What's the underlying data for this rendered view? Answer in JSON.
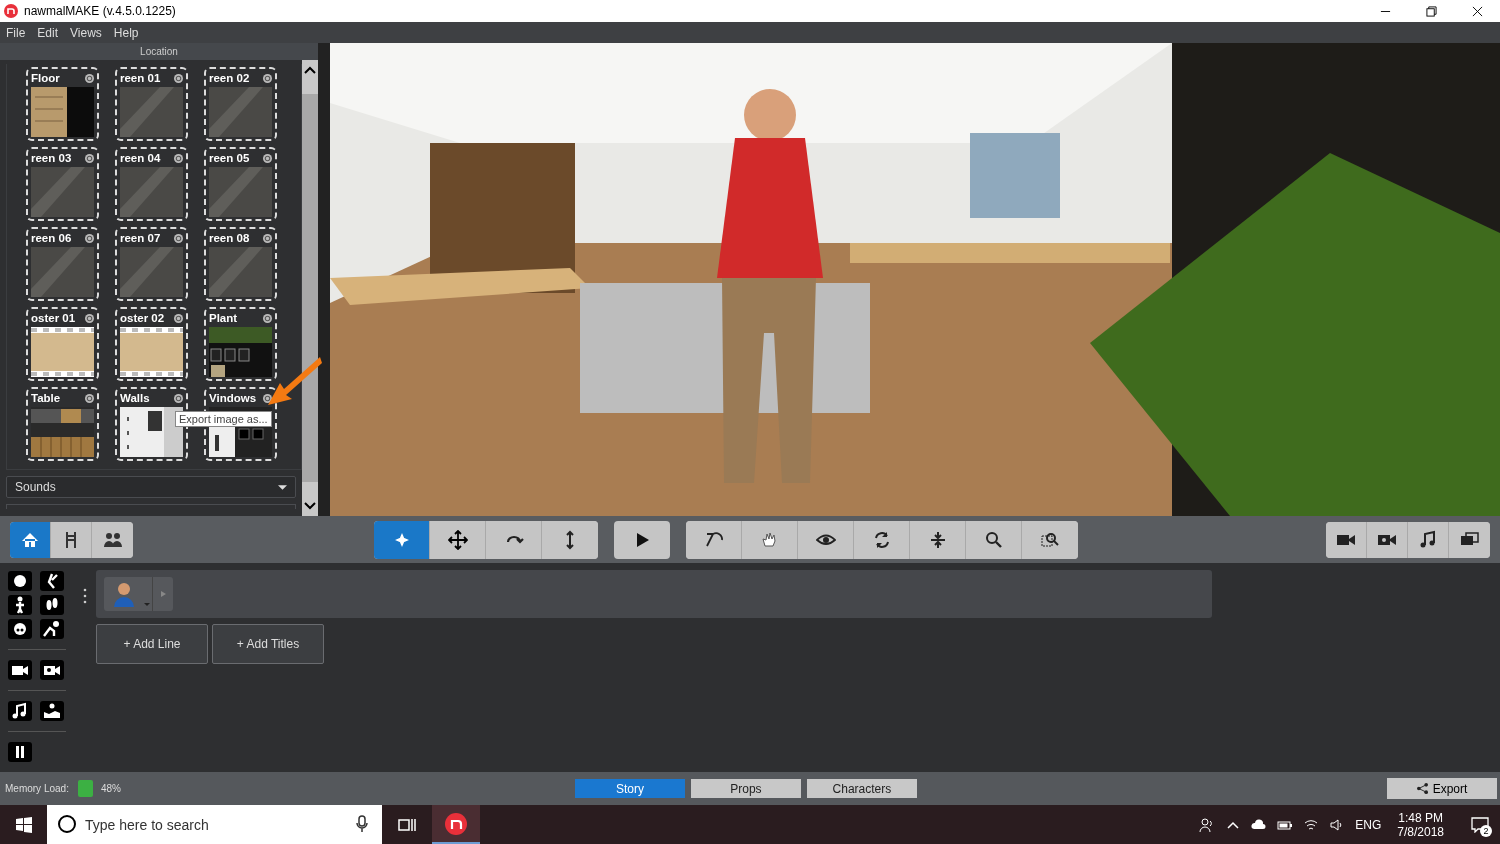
{
  "window": {
    "title": "nawmalMAKE (v.4.5.0.1225)"
  },
  "menu": [
    "File",
    "Edit",
    "Views",
    "Help"
  ],
  "location_panel": {
    "title": "Location",
    "tiles": [
      {
        "label": "Floor",
        "kind": "floor"
      },
      {
        "label": "reen 01",
        "kind": "screen"
      },
      {
        "label": "reen 02",
        "kind": "screen"
      },
      {
        "label": "reen 03",
        "kind": "screen"
      },
      {
        "label": "reen 04",
        "kind": "screen"
      },
      {
        "label": "reen 05",
        "kind": "screen"
      },
      {
        "label": "reen 06",
        "kind": "screen"
      },
      {
        "label": "reen 07",
        "kind": "screen"
      },
      {
        "label": "reen 08",
        "kind": "screen"
      },
      {
        "label": "oster 01",
        "kind": "poster"
      },
      {
        "label": "oster 02",
        "kind": "poster"
      },
      {
        "label": "Plant",
        "kind": "plant"
      },
      {
        "label": "Table",
        "kind": "table"
      },
      {
        "label": "Walls",
        "kind": "walls"
      },
      {
        "label": "Vindows",
        "kind": "windows"
      }
    ],
    "tooltip": "Export image as...",
    "sounds_dropdown": "Sounds"
  },
  "toolbar": {
    "left_tabs": [
      {
        "selected": true
      },
      {
        "selected": false
      },
      {
        "selected": false
      }
    ],
    "transform_tools": [
      {
        "selected": true
      },
      {
        "selected": false
      },
      {
        "selected": false
      },
      {
        "selected": false
      }
    ],
    "camera_tools": [
      {
        "selected": false
      },
      {
        "selected": false
      },
      {
        "selected": false
      },
      {
        "selected": false
      }
    ]
  },
  "timeline": {
    "buttons": [
      "+ Add Line",
      "+ Add Titles"
    ]
  },
  "status_bar": {
    "memory_label": "Memory Load:",
    "memory_value": "48%",
    "tabs": [
      {
        "label": "Story",
        "selected": true
      },
      {
        "label": "Props",
        "selected": false
      },
      {
        "label": "Characters",
        "selected": false
      }
    ],
    "export": "Export"
  },
  "taskbar": {
    "search_placeholder": "Type here to search",
    "language": "ENG",
    "time": "1:48 PM",
    "date": "7/8/2018",
    "notifications": "2"
  }
}
